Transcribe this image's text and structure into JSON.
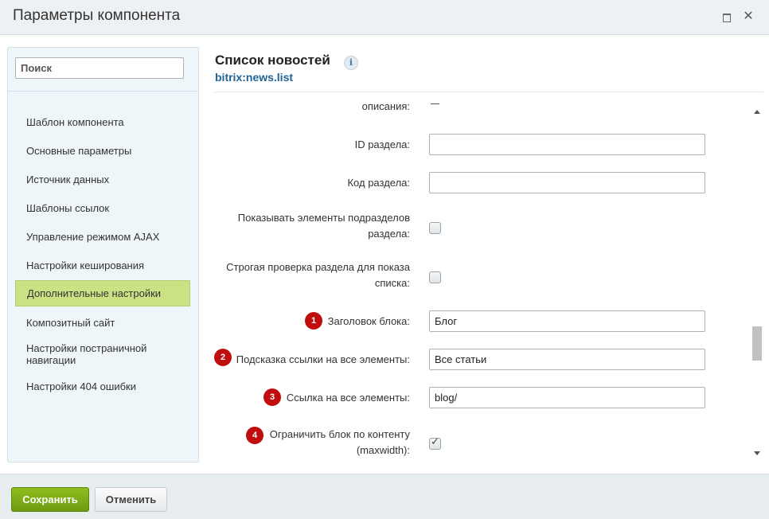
{
  "window": {
    "title": "Параметры компонента"
  },
  "sidebar": {
    "search_placeholder": "Поиск",
    "items": [
      {
        "label": "Шаблон компонента"
      },
      {
        "label": "Основные параметры"
      },
      {
        "label": "Источник данных"
      },
      {
        "label": "Шаблоны ссылок"
      },
      {
        "label": "Управление режимом AJAX"
      },
      {
        "label": "Настройки кеширования"
      },
      {
        "label": "Дополнительные настройки",
        "active": true
      },
      {
        "label": "Композитный сайт"
      },
      {
        "label": "Настройки постраничной навигации"
      },
      {
        "label": "Настройки 404 ошибки"
      }
    ]
  },
  "header": {
    "title": "Список новостей",
    "info_icon": "i",
    "code": "bitrix:news.list"
  },
  "form": {
    "fields": [
      {
        "label": "описания:",
        "type": "dash"
      },
      {
        "label": "ID раздела:",
        "type": "text",
        "value": ""
      },
      {
        "label": "Код раздела:",
        "type": "text",
        "value": ""
      },
      {
        "label_line1": "Показывать элементы подразделов",
        "label_line2": "раздела:",
        "type": "checkbox",
        "checked": false
      },
      {
        "label_line1": "Строгая проверка раздела для показа",
        "label_line2": "списка:",
        "type": "checkbox",
        "checked": false
      },
      {
        "label": "Заголовок блока:",
        "type": "text",
        "value": "Блог",
        "badge": "1"
      },
      {
        "label": "Подсказка ссылки на все элементы:",
        "type": "text",
        "value": "Все статьи",
        "badge": "2"
      },
      {
        "label": "Ссылка на все элементы:",
        "type": "text",
        "value": "blog/",
        "badge": "3"
      },
      {
        "label_line1": "Ограничить блок по контенту",
        "label_line2": "(maxwidth):",
        "type": "checkbox",
        "checked": true,
        "badge": "4"
      }
    ]
  },
  "footer": {
    "save_label": "Сохранить",
    "cancel_label": "Отменить"
  },
  "colors": {
    "accent_green": "#7aa615",
    "active_item": "#cbe284",
    "badge": "#c00d0d",
    "link": "#1f6296"
  }
}
